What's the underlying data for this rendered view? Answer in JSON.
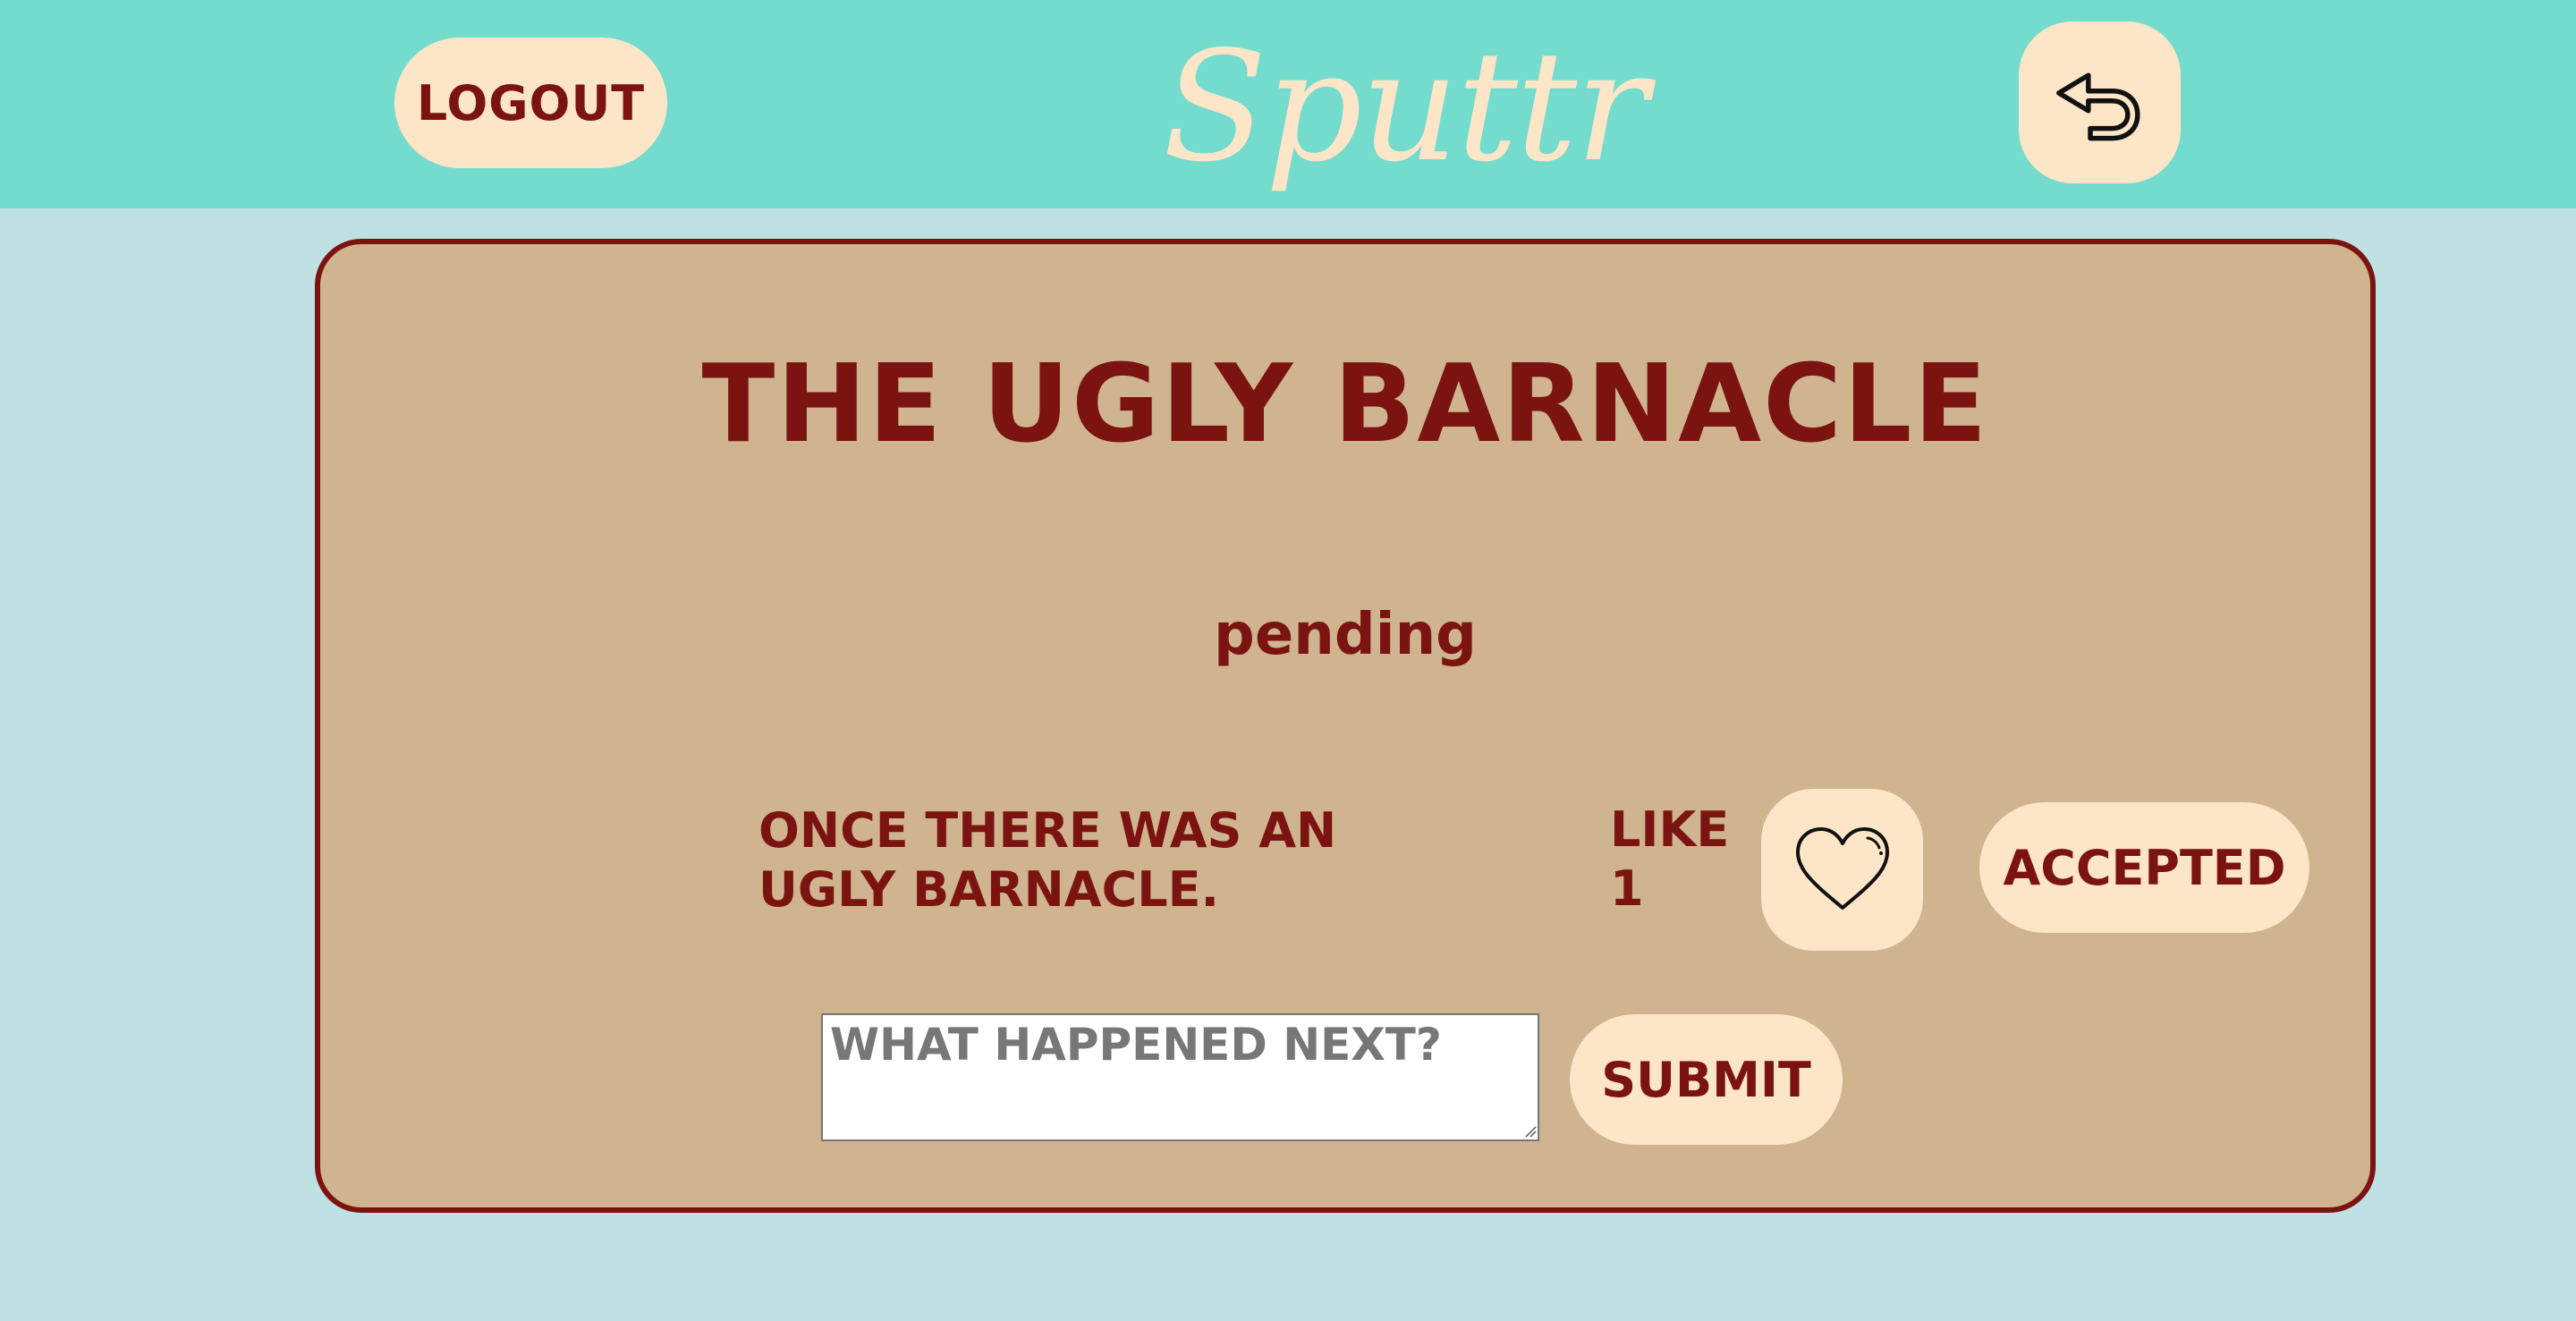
{
  "header": {
    "logout_label": "LOGOUT",
    "brand": "Sputtr",
    "back_icon": "undo-arrow-icon"
  },
  "story": {
    "title": "THE UGLY BARNACLE",
    "status": "pending",
    "text": "ONCE THERE WAS AN UGLY BARNACLE.",
    "like_label": "LIKE",
    "like_count": "1",
    "heart_icon": "heart-icon",
    "accepted_label": "ACCEPTED"
  },
  "contribution": {
    "placeholder": "WHAT HAPPENED NEXT?",
    "submit_label": "SUBMIT"
  },
  "colors": {
    "header_bg": "#74dccd",
    "page_bg": "#bfe1e4",
    "card_bg": "#cfb48f",
    "accent": "#7b1410",
    "button_bg": "#fde5c8"
  }
}
